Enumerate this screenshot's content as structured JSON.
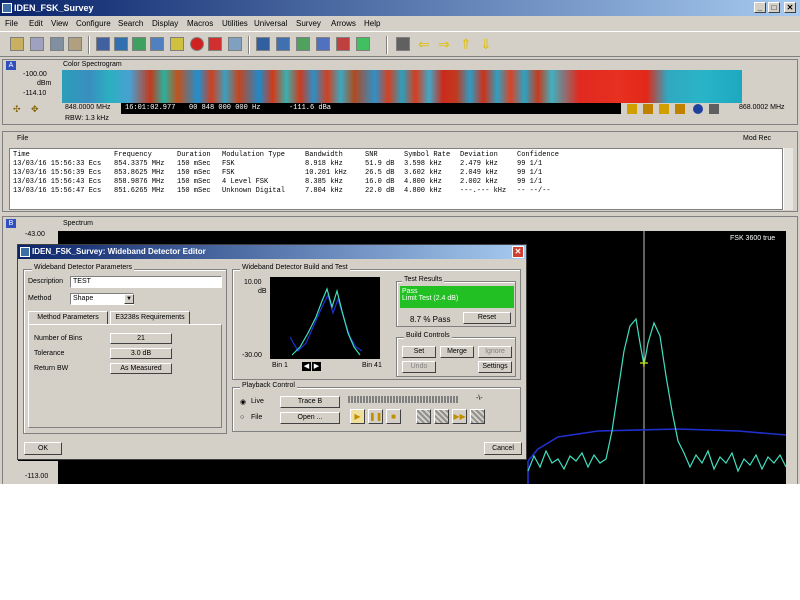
{
  "window": {
    "title": "IDEN_FSK_Survey"
  },
  "menu": [
    "File",
    "Edit",
    "View",
    "Configure",
    "Search",
    "Display",
    "Macros",
    "Utilities",
    "Universal",
    "Survey",
    "Arrows",
    "Help"
  ],
  "colors": {
    "title_bar": "#0a246a",
    "spectrum_trace": "#40e0c0",
    "detector_trace": "#2030d0",
    "pass_green": "#22c022",
    "spectrogram_hot": "#e02a20",
    "spectrogram_cool": "#2aa4c4"
  },
  "panel_a": {
    "badge": "A",
    "title": "Color Spectrogram",
    "y_top": "-100.00",
    "y_unit": "dBm",
    "y_bottom": "-114.10",
    "freq_start": "848.0000 MHz",
    "time_readout": "16:01:02.977",
    "freq_readout": "00 848 000 000 Hz",
    "level_readout": "-111.6 dBa",
    "freq_end": "868.0002 MHz",
    "rbw": "RBW: 1.3 kHz"
  },
  "panel_file": {
    "title": "File",
    "right_label": "Mod Rec",
    "columns": [
      "Time",
      "Frequency",
      "Duration",
      "Modulation Type",
      "Bandwidth",
      "SNR",
      "Symbol Rate",
      "Deviation",
      "Confidence"
    ],
    "rows": [
      [
        "13/03/16 15:56:33 Ecs",
        "854.3375 MHz",
        "150 mSec",
        "FSK",
        "8.918 kHz",
        "51.9 dB",
        "3.598 kHz",
        "2.479 kHz",
        "99  1/1"
      ],
      [
        "13/03/16 15:56:39 Ecs",
        "853.8625 MHz",
        "150 mSec",
        "FSK",
        "10.201 kHz",
        "26.5 dB",
        "3.602 kHz",
        "2.049 kHz",
        "99  1/1"
      ],
      [
        "13/03/16 15:56:43 Ecs",
        "858.9876 MHz",
        "150 mSec",
        "4 Level FSK",
        "8.385 kHz",
        "16.0 dB",
        "4.800 kHz",
        "2.002 kHz",
        "99  1/1"
      ],
      [
        "13/03/16 15:56:47 Ecs",
        "851.6265 MHz",
        "150 mSec",
        "Unknown Digital",
        "7.804 kHz",
        "22.0 dB",
        "4.800 kHz",
        "---.--- kHz",
        "--  --/--"
      ]
    ]
  },
  "panel_b": {
    "badge": "B",
    "title": "Spectrum",
    "y_top": "-43.00",
    "y_bottom": "-113.00",
    "trace_label": "FSK 3600 true"
  },
  "dialog": {
    "title": "IDEN_FSK_Survey: Wideband Detector Editor",
    "close": "✕",
    "params": {
      "group": "Wideband Detector Parameters",
      "description_label": "Description",
      "description_value": "TEST",
      "method_label": "Method",
      "method_value": "Shape",
      "tab_method": "Method Parameters",
      "tab_req": "E3238s Requirements",
      "bins_label": "Number of Bins",
      "bins_value": "21",
      "tolerance_label": "Tolerance",
      "tolerance_value": "3.0 dB",
      "return_bw_label": "Return BW",
      "return_bw_value": "As Measured"
    },
    "build": {
      "group": "Wideband Detector Build and Test",
      "y_top": "10.00",
      "y_unit": "dB",
      "y_bottom": "-30.00",
      "bin_start": "Bin 1",
      "bin_end": "Bin 41",
      "results_group": "Test Results",
      "result_pass": "Pass",
      "result_detail": "Limit Test (2.4 dB)",
      "pass_pct": "8.7 % Pass",
      "reset": "Reset",
      "controls_group": "Build Controls",
      "set": "Set",
      "merge": "Merge",
      "ignore": "Ignore",
      "undo": "Undo",
      "settings": "Settings"
    },
    "playback": {
      "group": "Playback Control",
      "live": "Live",
      "trace": "Trace B",
      "file": "File",
      "open": "Open ...",
      "status": "-\\-"
    },
    "ok": "OK",
    "cancel": "Cancel"
  }
}
